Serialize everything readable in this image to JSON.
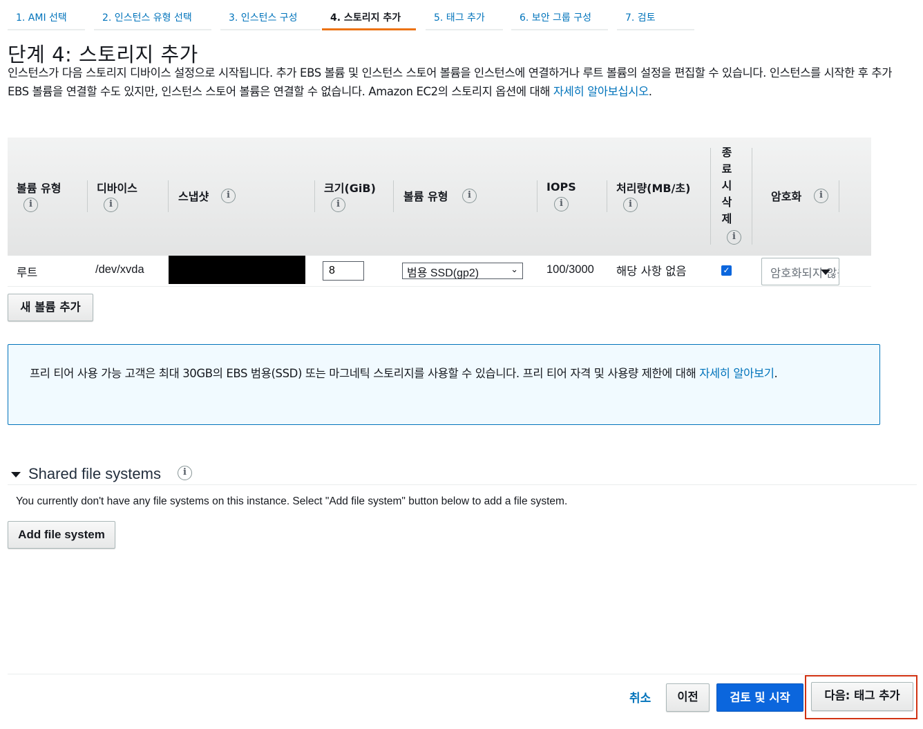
{
  "tabs": [
    {
      "label": "1. AMI 선택"
    },
    {
      "label": "2. 인스턴스 유형 선택"
    },
    {
      "label": "3. 인스턴스 구성"
    },
    {
      "label": "4. 스토리지 추가",
      "active": true
    },
    {
      "label": "5. 태그 추가"
    },
    {
      "label": "6. 보안 그룹 구성"
    },
    {
      "label": "7. 검토"
    }
  ],
  "page": {
    "title": "단계 4: 스토리지 추가",
    "desc_text": "인스턴스가 다음 스토리지 디바이스 설정으로 시작됩니다. 추가 EBS 볼륨 및 인스턴스 스토어 볼륨을 인스턴스에 연결하거나 루트 볼륨의 설정을 편집할 수 있습니다. 인스턴스를 시작한 후 추가 EBS 볼륨을 연결할 수도 있지만, 인스턴스 스토어 볼륨은 연결할 수 없습니다. Amazon EC2의 스토리지 옵션에 대해 ",
    "desc_link": "자세히 알아보십시오",
    "desc_end": "."
  },
  "table": {
    "headers": {
      "volume_type": "볼륨 유형",
      "device": "디바이스",
      "snapshot": "스냅샷",
      "size": "크기(GiB)",
      "ebs_type": "볼륨 유형",
      "iops": "IOPS",
      "throughput": "처리량(MB/초)",
      "delete_on_termination": [
        "종",
        "료",
        "시",
        "삭",
        "제"
      ],
      "encryption": "암호화"
    },
    "row": {
      "volume_type": "루트",
      "device": "/dev/xvda",
      "size": "8",
      "ebs_type": "범용 SSD(gp2)",
      "iops": "100/3000",
      "throughput": "해당 사항 없음",
      "delete_on_termination": true,
      "encryption": "암호화되지 않음"
    }
  },
  "buttons": {
    "add_volume": "새 볼륨 추가",
    "add_file_system": "Add file system",
    "cancel": "취소",
    "previous": "이전",
    "review_launch": "검토 및 시작",
    "next": "다음: 태그 추가"
  },
  "info_box": {
    "text": "프리 티어 사용 가능 고객은 최대 30GB의 EBS 범용(SSD) 또는 마그네틱 스토리지를 사용할 수 있습니다. 프리 티어 자격 및 사용량 제한에 대해 ",
    "link": "자세히 알아보기",
    "end": "."
  },
  "shared_fs": {
    "title": "Shared file systems",
    "message": "You currently don't have any file systems on this instance. Select \"Add file system\" button below to add a file system."
  },
  "icons": {
    "info": "i",
    "check": "✓"
  },
  "colors": {
    "accent_orange": "#ec7211",
    "link_blue": "#0073bb",
    "primary_blue": "#0b66dd",
    "highlight_red": "#d13212"
  }
}
